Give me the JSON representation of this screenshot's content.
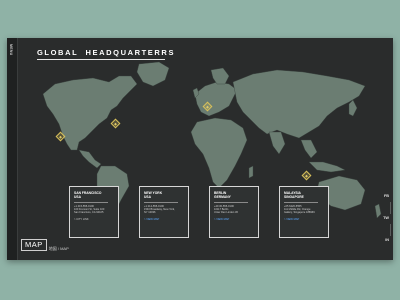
{
  "sidebar": {
    "label": "MENU"
  },
  "header": {
    "title": "GLOBAL  HEADQUARTERRS"
  },
  "locations": [
    {
      "city": "SAN FRANCISCO",
      "country": "USA",
      "lines": [
        "+1 415-555-0100",
        "100 Fremont St, Suite 100",
        "San Francisco, CA 94105"
      ],
      "link": "> CITY LINK"
    },
    {
      "city": "NEW YORK",
      "country": "USA",
      "lines": [
        "+1 212-555-0100",
        "1540 Broadway, New York,",
        "NY 10036"
      ],
      "link": "> VIEW MAP"
    },
    {
      "city": "BERLIN",
      "country": "GERMANY",
      "lines": [
        "+49 30-555-0100",
        "10117 Berlin",
        "Unter Den Linden 36"
      ],
      "link": "> VIEW MAP"
    },
    {
      "city": "MALAYSIA",
      "country": "SINGAPORE",
      "lines": [
        "+65 6220-5555",
        "111 Middle Rd, Orange",
        "Gallery, Singapore 188969"
      ],
      "link": "> VIEW MAP"
    }
  ],
  "map_label": {
    "title": "MAP",
    "subtitle": "地図 / MAP"
  },
  "pagination": [
    "FB",
    "TW",
    "IN"
  ],
  "colors": {
    "background": "#8fb2a6",
    "panel": "#2a2c2c",
    "land": "#6b7d72",
    "marker": "#d8c05a",
    "link": "#5aa7ff"
  }
}
